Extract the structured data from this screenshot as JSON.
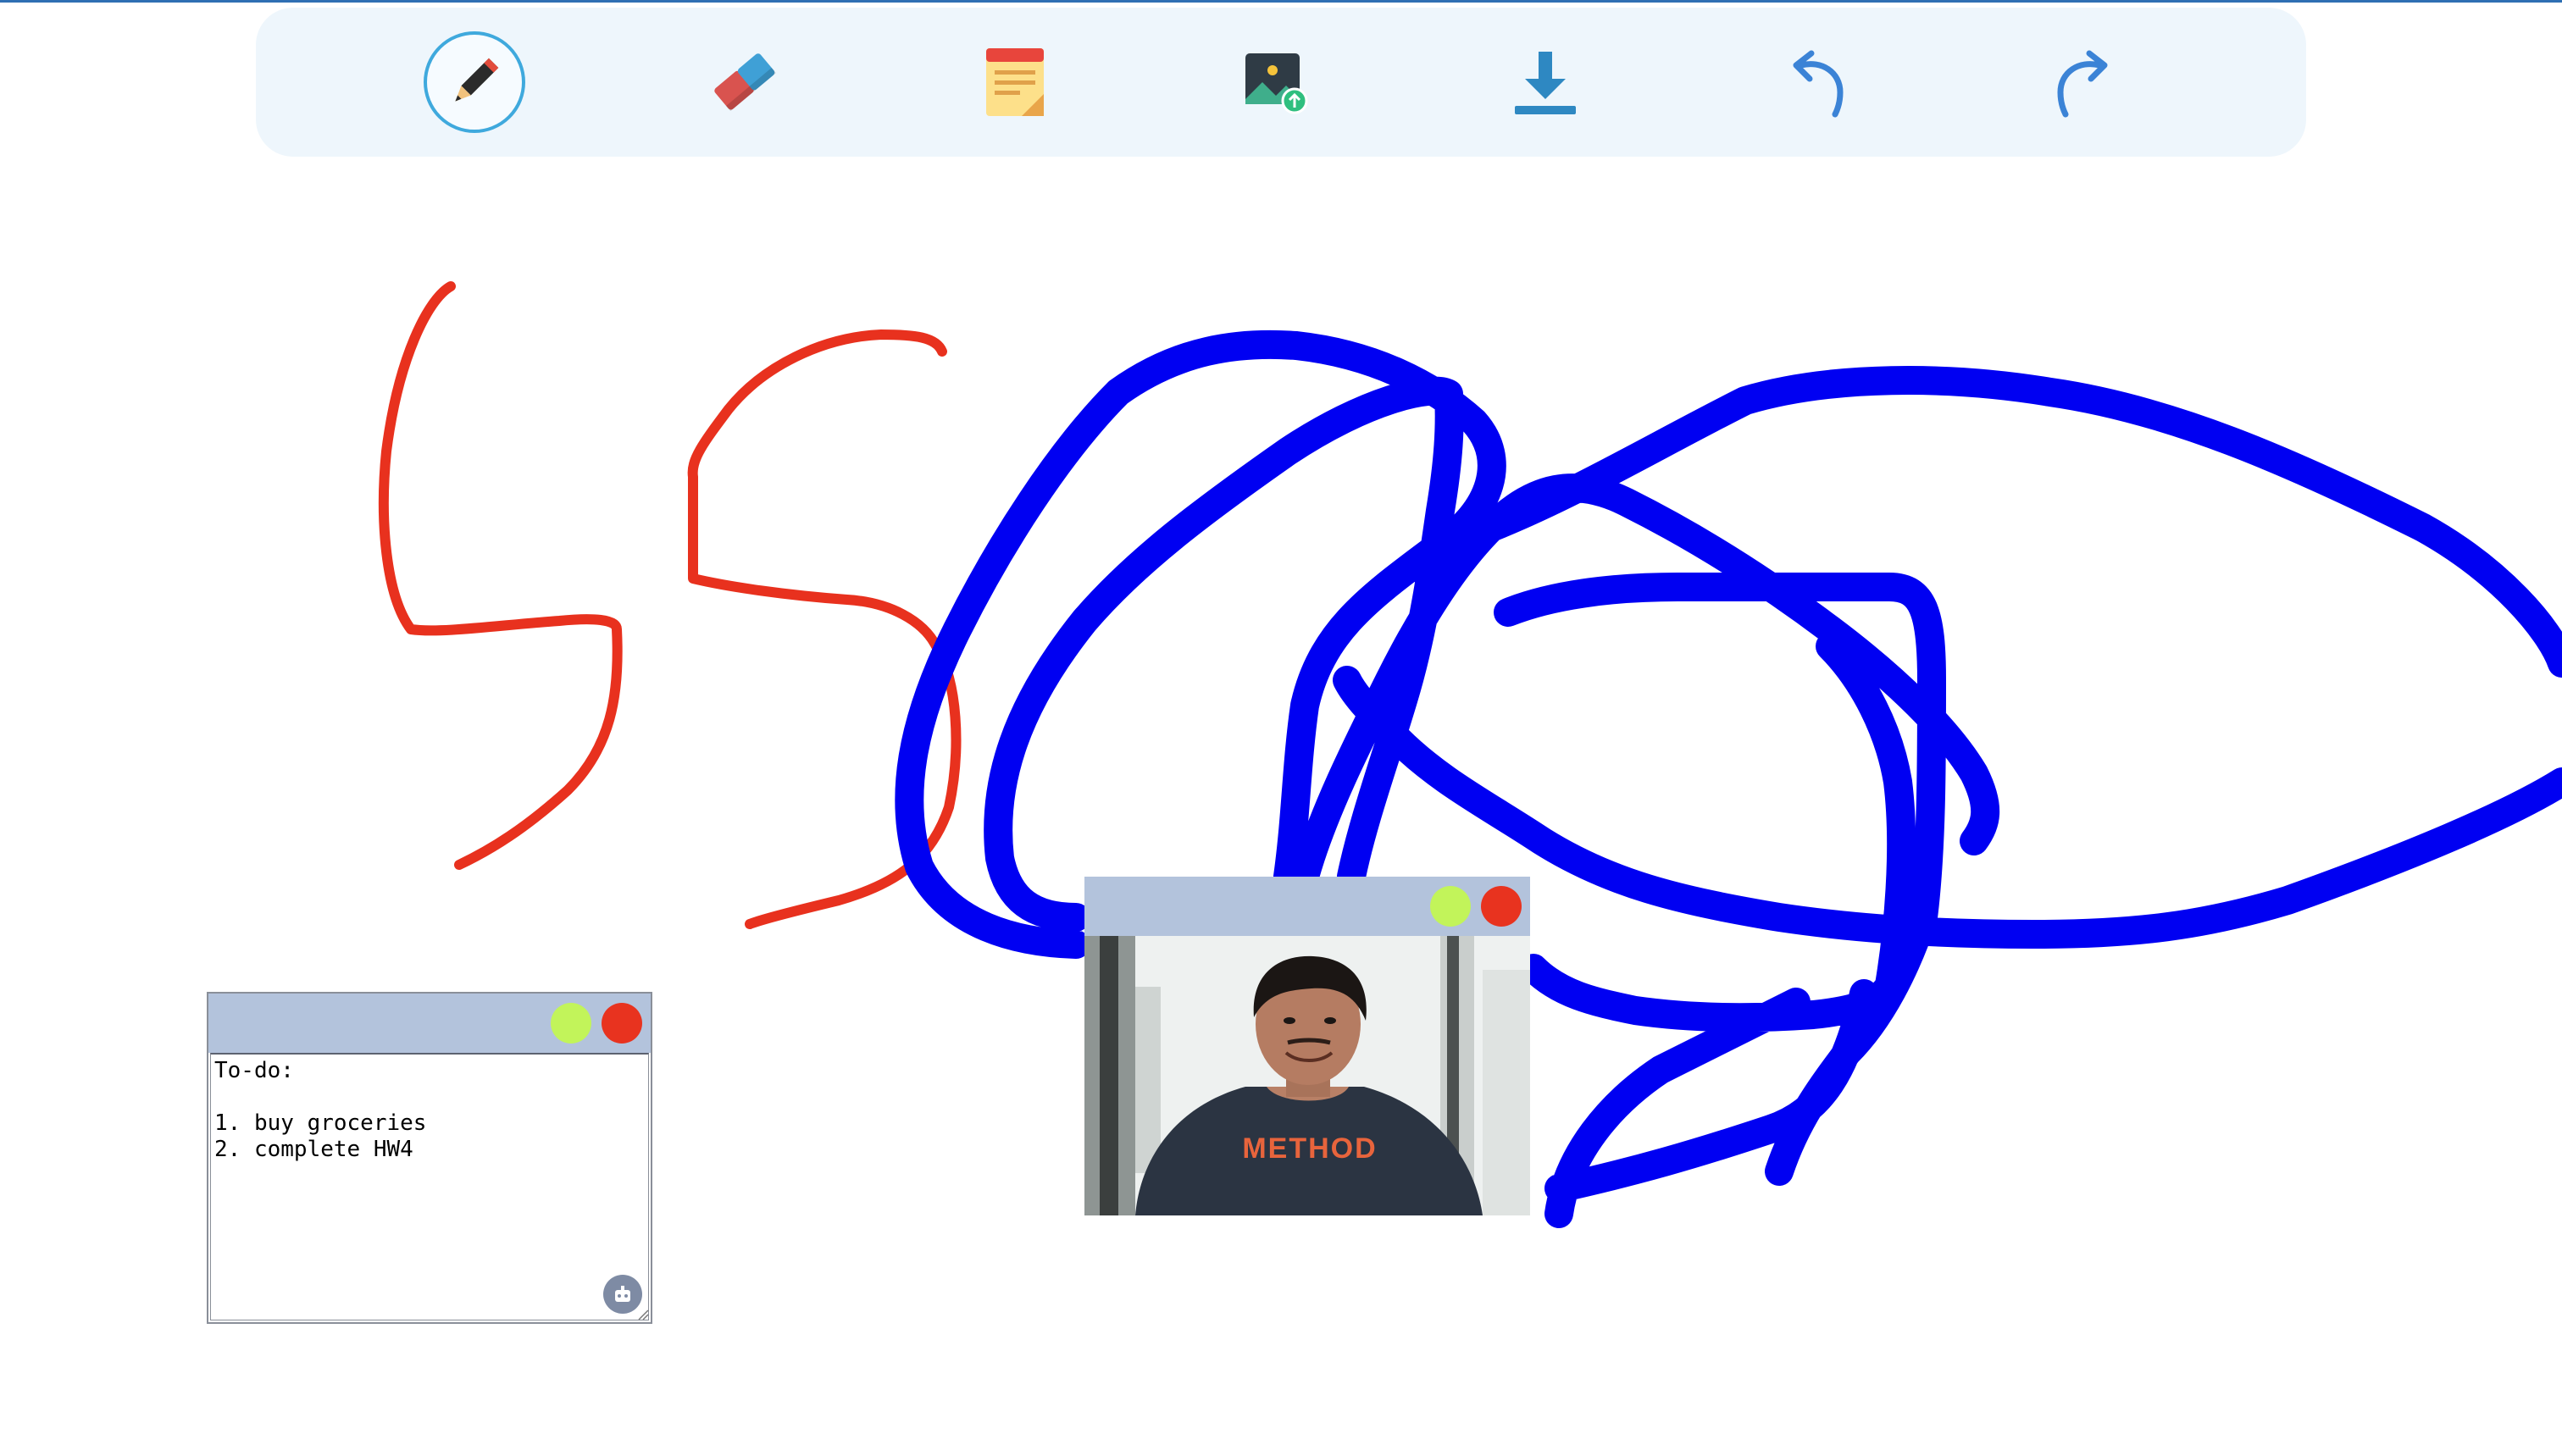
{
  "toolbar": {
    "tools": [
      {
        "name": "pencil",
        "icon": "pencil-icon",
        "active": true
      },
      {
        "name": "eraser",
        "icon": "eraser-icon",
        "active": false
      },
      {
        "name": "sticky-note",
        "icon": "sticky-note-icon",
        "active": false
      },
      {
        "name": "image-upload",
        "icon": "image-upload-icon",
        "active": false
      },
      {
        "name": "download",
        "icon": "download-icon",
        "active": false
      },
      {
        "name": "undo",
        "icon": "undo-icon",
        "active": false
      },
      {
        "name": "redo",
        "icon": "redo-icon",
        "active": false
      }
    ]
  },
  "colors": {
    "stroke_red": "#e8311e",
    "stroke_blue": "#0000f2",
    "window_header": "#b3c3dc",
    "close_button": "#e8331f",
    "minimize_button": "#c2f45a",
    "toolbar_bg": "#eef6fc",
    "active_ring": "#3fa9dd"
  },
  "sticky_note": {
    "text": "To-do:\n\n1. buy groceries\n2. complete HW4"
  },
  "image_window": {
    "shirt_text": "METHOD"
  }
}
